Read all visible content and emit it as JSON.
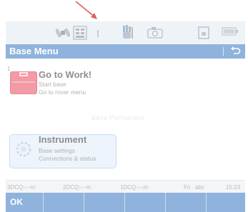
{
  "title_bar": {
    "title": "Base Menu",
    "back_icon": "back-arrow-icon"
  },
  "menu": {
    "items": [
      {
        "number": "1",
        "title": "Go to Work!",
        "lines": [
          "Start base",
          "Go to rover menu"
        ],
        "icon": "briefcase-icon",
        "color": "#f39aa4"
      },
      {
        "number": "",
        "title": "Instrument",
        "lines": [
          "Base settings",
          "Connections & status"
        ],
        "icon": "gear-icon"
      }
    ],
    "watermark": "Base Permanent"
  },
  "bottom_bar": {
    "q3d": "3DCQ:---m",
    "q2d": "2DCQ:---m",
    "q1d": "1DCQ:---m",
    "mode": "Fn",
    "input_mode": "abc",
    "time": "15:23"
  },
  "softkeys": {
    "ok": "OK"
  },
  "colors": {
    "accent": "#8fb3dc",
    "status_bar": "#eef3f7"
  },
  "status_icons": [
    "satellite-icon",
    "grid-keypad-icon",
    "antenna-icon",
    "hand-icon",
    "camera-icon",
    "memory-card-icon",
    "battery-icon"
  ]
}
